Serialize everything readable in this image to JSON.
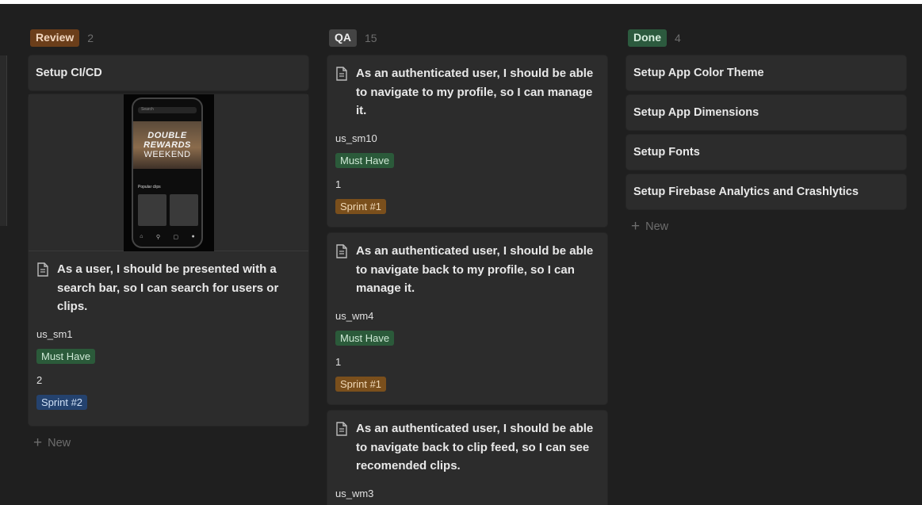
{
  "columns": [
    {
      "status": "Review",
      "count": "2",
      "pill_bg": "#6b3e1a",
      "pill_fg": "#f2d7c0",
      "new_label": "New"
    },
    {
      "status": "QA",
      "count": "15",
      "pill_bg": "#444444",
      "pill_fg": "#eeeeee"
    },
    {
      "status": "Done",
      "count": "4",
      "pill_bg": "#2c5a3e",
      "pill_fg": "#d8efdf",
      "new_label": "New"
    }
  ],
  "review": {
    "card1_title": "Setup CI/CD",
    "cover": {
      "search_text": "Search",
      "hero_line1": "DOUBLE",
      "hero_line2": "REWARDS",
      "hero_line3": "WEEKEND",
      "section_label": "Popular clips"
    },
    "card2": {
      "title": "As a user, I should be presented with a search bar, so I can search for users or clips.",
      "id": "us_sm1",
      "priority": "Must Have",
      "points": "2",
      "sprint": "Sprint #2"
    }
  },
  "qa": [
    {
      "title": "As an authenticated user, I should be able to navigate to my profile, so I can manage it.",
      "id": "us_sm10",
      "priority": "Must Have",
      "points": "1",
      "sprint": "Sprint #1"
    },
    {
      "title": "As an authenticated user, I should be able to navigate back to my profile, so I can manage it.",
      "id": "us_wm4",
      "priority": "Must Have",
      "points": "1",
      "sprint": "Sprint #1"
    },
    {
      "title": "As an authenticated user, I should be able to navigate back to clip feed, so I can see recomended clips.",
      "id": "us_wm3"
    }
  ],
  "done": [
    "Setup App Color Theme",
    "Setup App Dimensions",
    "Setup Fonts",
    "Setup Firebase Analytics and Crashlytics"
  ],
  "tag_colors": {
    "must_have_bg": "#2b5a3a",
    "must_have_fg": "#cfe9d6",
    "sprint1_bg": "#7a4f1c",
    "sprint1_fg": "#f0d9b8",
    "sprint2_bg": "#24426e",
    "sprint2_fg": "#cfe0f7"
  }
}
